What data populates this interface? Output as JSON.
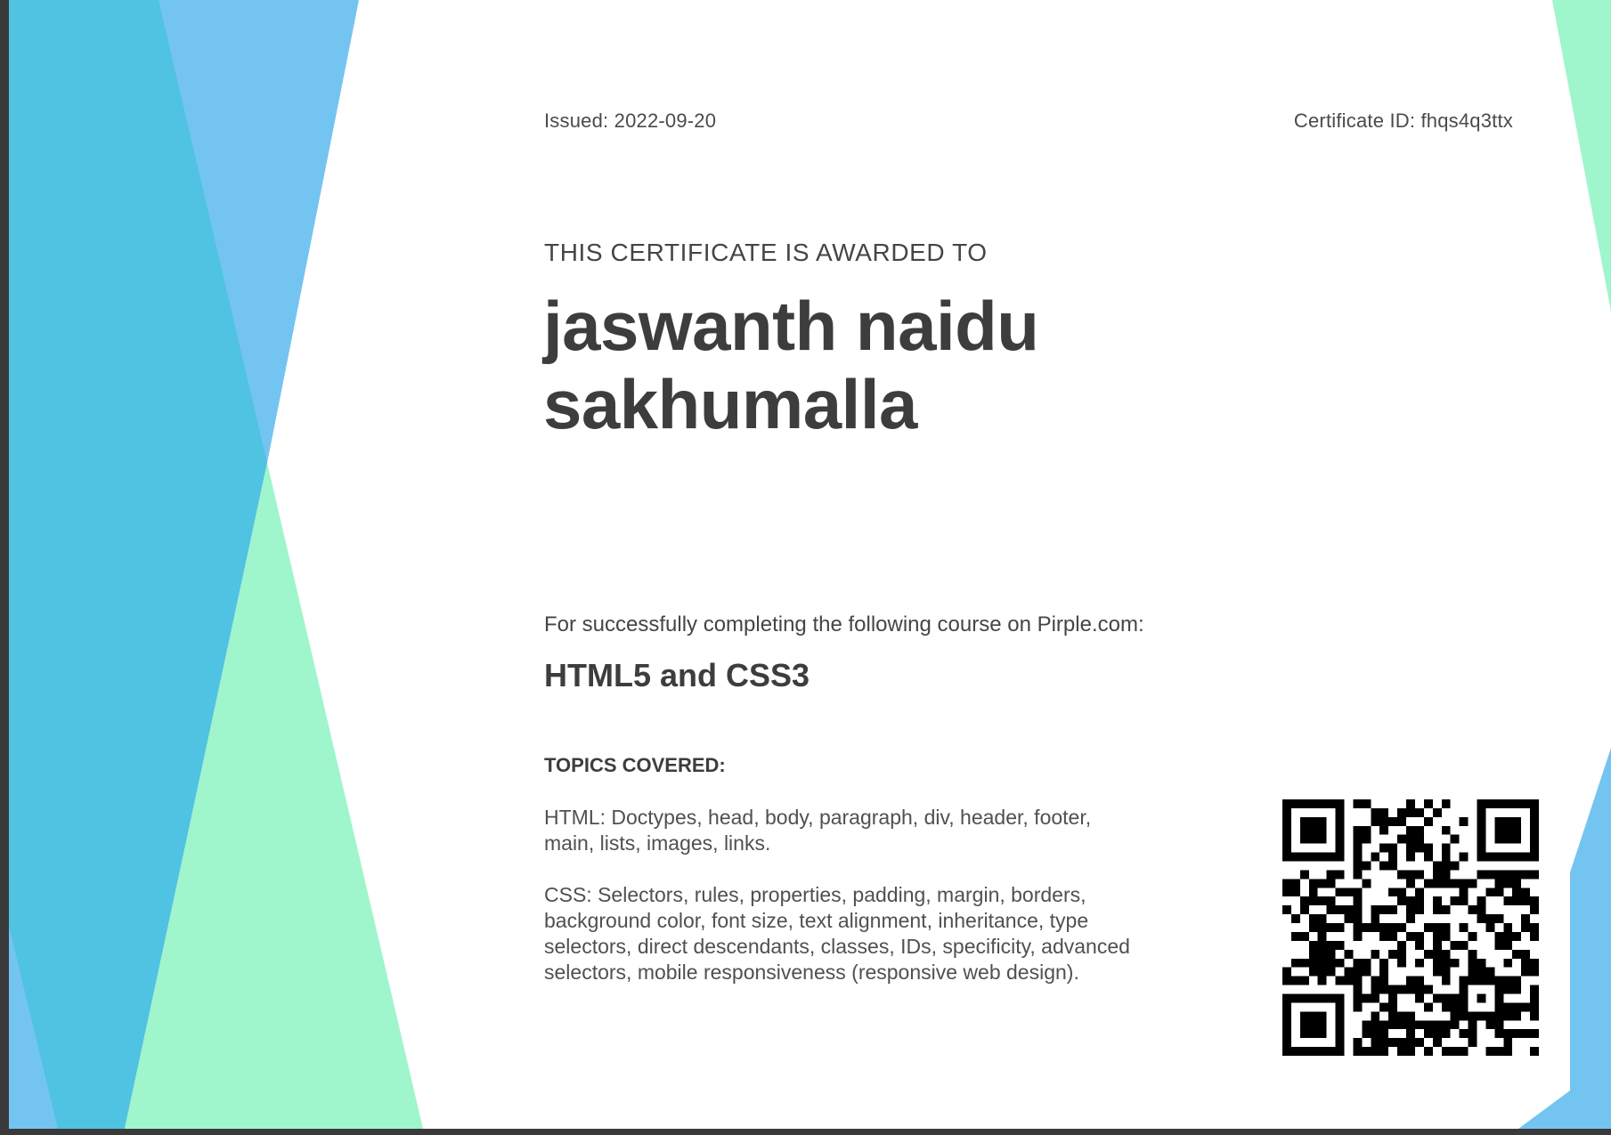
{
  "certificate": {
    "issued": "Issued: 2022-09-20",
    "certificate_id": "Certificate ID: fhqs4q3ttx",
    "awarded_heading": "THIS CERTIFICATE IS AWARDED TO",
    "recipient_line1": "jaswanth naidu",
    "recipient_line2": "sakhumalla",
    "completion_text": "For successfully completing the following course on Pirple.com:",
    "course_name": "HTML5 and CSS3",
    "topics_heading": "TOPICS COVERED:",
    "topic_html": "HTML: Doctypes, head, body, paragraph, div, header, footer, main, lists, images, links.",
    "topic_css": "CSS: Selectors, rules, properties, padding, margin, borders, background color, font size, text alignment, inheritance, type selectors, direct descendants, classes, IDs, specificity, advanced selectors, mobile responsiveness (responsive web design)."
  },
  "colors": {
    "background": "#ffffff",
    "sky_blue": "#74c4f2",
    "cyan": "#50c2e2",
    "mint": "#9ff5cc",
    "text": "#3f3f3f"
  },
  "icons": {
    "qr": "qr-code-icon"
  }
}
